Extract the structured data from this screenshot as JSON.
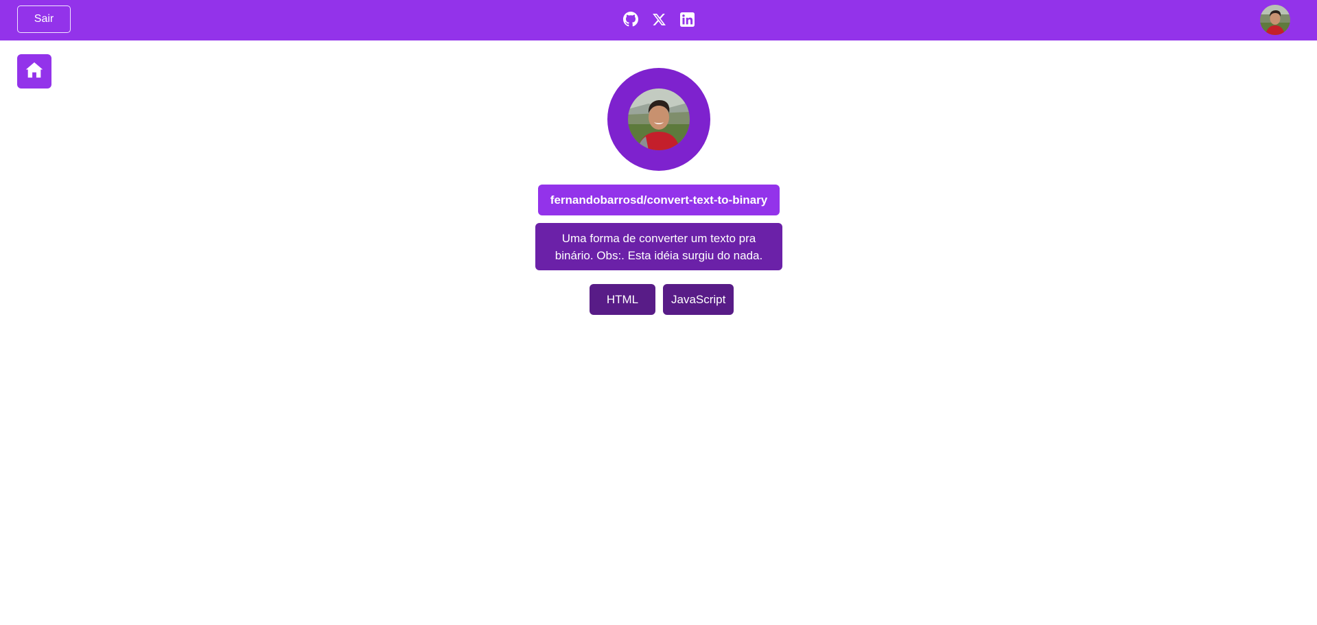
{
  "colors": {
    "topbar": "#9333ea",
    "home_button": "#9333ea",
    "profile_ring": "#7e22ce",
    "repo_name_bg": "#9333ea",
    "repo_desc_bg": "#6b21a8",
    "lang_chip_bg": "#581c87",
    "text": "#ffffff"
  },
  "header": {
    "logout_label": "Sair",
    "social_icons": [
      "github-icon",
      "x-icon",
      "linkedin-icon"
    ]
  },
  "nav": {
    "home_icon": "home-icon"
  },
  "repo": {
    "name": "fernandobarrosd/convert-text-to-binary",
    "description": "Uma forma de converter um texto pra binário. Obs:. Esta idéia surgiu do nada.",
    "languages": [
      "HTML",
      "JavaScript"
    ]
  }
}
